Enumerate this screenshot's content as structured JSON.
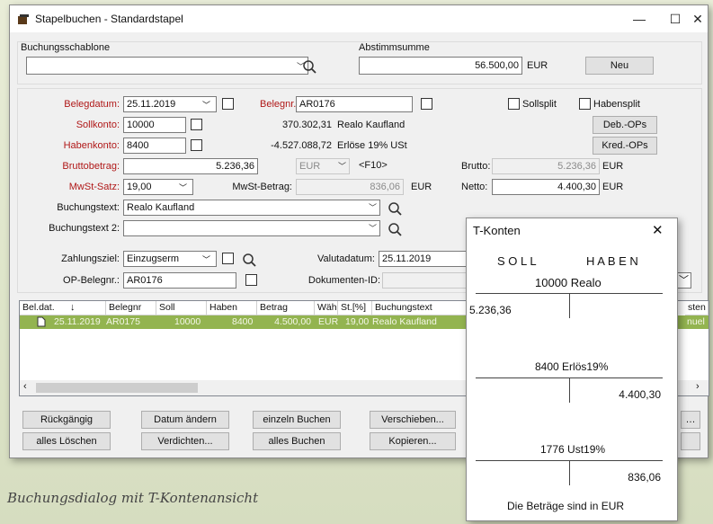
{
  "window": {
    "title": "Stapelbuchen - Standardstapel",
    "minimize": "—",
    "maximize": "☐",
    "close": "✕"
  },
  "top": {
    "template_label": "Buchungsschablone",
    "abstimm_label": "Abstimmsumme",
    "abstimm_value": "56.500,00",
    "currency": "EUR",
    "neu": "Neu"
  },
  "form": {
    "belegdatum_label": "Belegdatum:",
    "belegdatum": "25.11.2019",
    "belegnr_label": "Belegnr.:",
    "belegnr": "AR0176",
    "sollsplit": "Sollsplit",
    "habensplit": "Habensplit",
    "sollkonto_label": "Sollkonto:",
    "sollkonto": "10000",
    "soll_amount": "370.302,31",
    "soll_name": "Realo Kaufland",
    "deb_ops": "Deb.-OPs",
    "habenkonto_label": "Habenkonto:",
    "habenkonto": "8400",
    "haben_amount": "-4.527.088,72",
    "haben_name": "Erlöse 19% USt",
    "kred_ops": "Kred.-OPs",
    "brutto_label": "Bruttobetrag:",
    "brutto": "5.236,36",
    "brutto_cur": "EUR",
    "f10": "<F10>",
    "brutto2_label": "Brutto:",
    "brutto2": "5.236,36",
    "brutto2_cur": "EUR",
    "mwst_label": "MwSt-Satz:",
    "mwst": "19,00",
    "mwstbetrag_label": "MwSt-Betrag:",
    "mwstbetrag": "836,06",
    "mwstbetrag_cur": "EUR",
    "netto_label": "Netto:",
    "netto": "4.400,30",
    "netto_cur": "EUR",
    "text_label": "Buchungstext:",
    "text": "Realo Kaufland",
    "text2_label": "Buchungstext 2:",
    "text2": "",
    "zahlungsziel_label": "Zahlungsziel:",
    "zahlungsziel": "Einzugserm",
    "valuta_label": "Valutadatum:",
    "valuta": "25.11.2019",
    "op_label": "OP-Belegnr.:",
    "op": "AR0176",
    "dok_label": "Dokumenten-ID:"
  },
  "grid": {
    "headers": [
      "Bel.dat.",
      "Belegnr",
      "Soll",
      "Haben",
      "Betrag",
      "Wäh",
      "St.[%]",
      "Buchungstext",
      "sten"
    ],
    "row": [
      "25.11.2019",
      "AR0175",
      "10000",
      "8400",
      "4.500,00",
      "EUR",
      "19,00",
      "Realo Kaufland",
      "nuel"
    ]
  },
  "buttons": {
    "rueckgaengig": "Rückgängig",
    "datum": "Datum ändern",
    "einzeln": "einzeln Buchen",
    "verschieben": "Verschieben...",
    "loeschen": "alles Löschen",
    "verdichten": "Verdichten...",
    "alles": "alles Buchen",
    "kopieren": "Kopieren..."
  },
  "tkonten": {
    "title": "T-Konten",
    "close": "✕",
    "soll": "S O L L",
    "haben": "H A B E N",
    "acc1": "10000 Realo",
    "acc1_soll": "5.236,36",
    "acc2": "8400 Erlös19%",
    "acc2_haben": "4.400,30",
    "acc3": "1776 Ust19%",
    "acc3_haben": "836,06",
    "footer": "Die Beträge sind in EUR"
  },
  "caption": "Buchungsdialog mit T-Kontenansicht"
}
